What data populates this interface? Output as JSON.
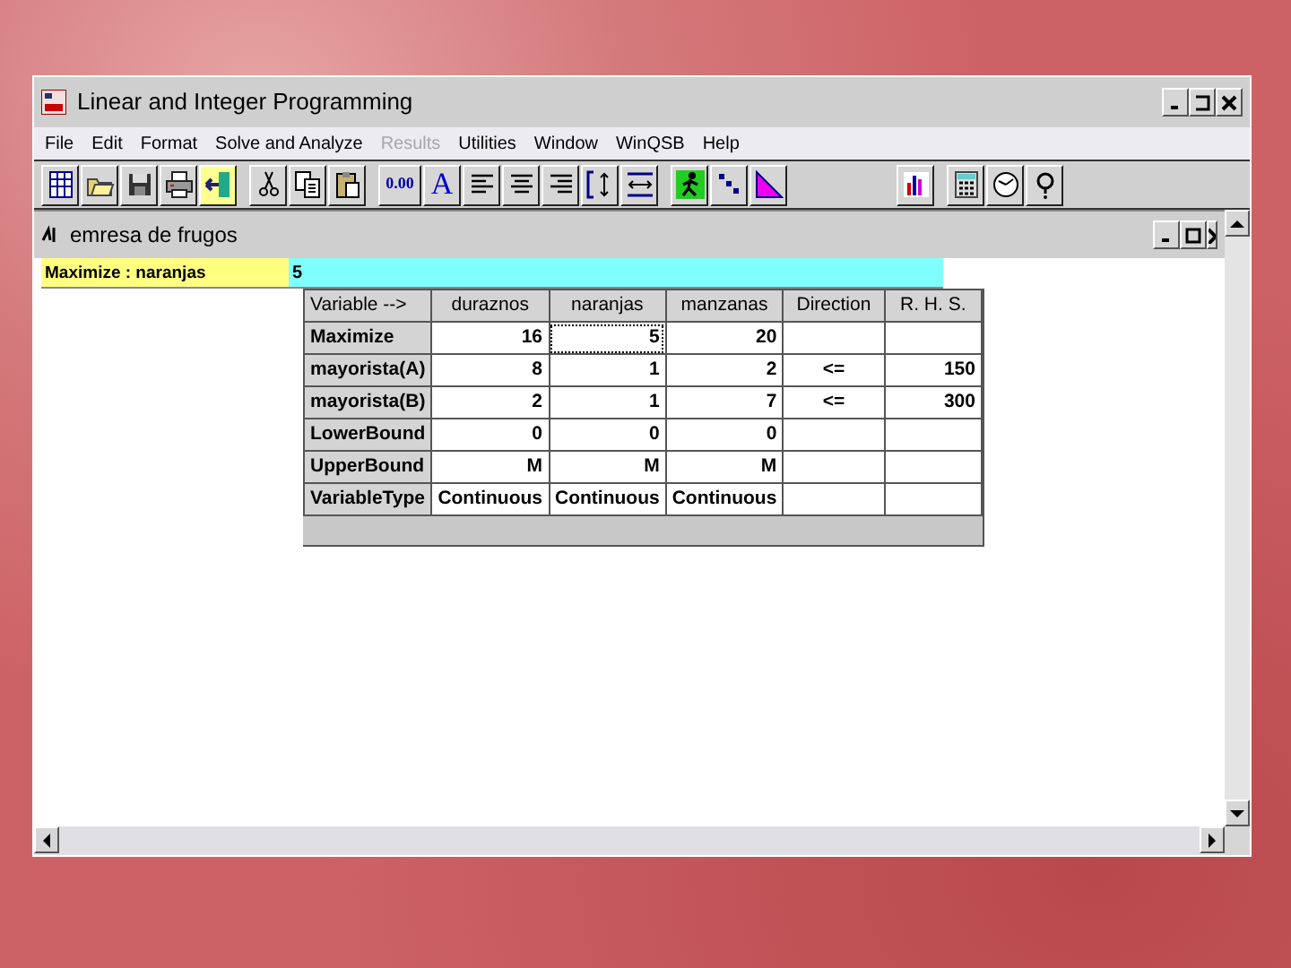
{
  "window": {
    "title": "Linear and Integer Programming"
  },
  "menu": [
    {
      "label": "File",
      "disabled": false
    },
    {
      "label": "Edit",
      "disabled": false
    },
    {
      "label": "Format",
      "disabled": false
    },
    {
      "label": "Solve and Analyze",
      "disabled": false
    },
    {
      "label": "Results",
      "disabled": true
    },
    {
      "label": "Utilities",
      "disabled": false
    },
    {
      "label": "Window",
      "disabled": false
    },
    {
      "label": "WinQSB",
      "disabled": false
    },
    {
      "label": "Help",
      "disabled": false
    }
  ],
  "toolbar": {
    "number_format": "0.00",
    "font": "A"
  },
  "document": {
    "title": "emresa de frugos",
    "cell_label": "Maximize : naranjas",
    "cell_value": "5",
    "table": {
      "columns": [
        "Variable -->",
        "duraznos",
        "naranjas",
        "manzanas",
        "Direction",
        "R. H. S."
      ],
      "rows": [
        [
          {
            "text": "Maximize",
            "selected": false
          },
          {
            "text": "16",
            "selected": false
          },
          {
            "text": "5",
            "selected": true
          },
          {
            "text": "20",
            "selected": false
          },
          {
            "text": "",
            "selected": false
          },
          {
            "text": "",
            "selected": false
          }
        ],
        [
          {
            "text": "mayorista(A)",
            "selected": false
          },
          {
            "text": "8",
            "selected": false
          },
          {
            "text": "1",
            "selected": false
          },
          {
            "text": "2",
            "selected": false
          },
          {
            "text": "<=",
            "selected": false
          },
          {
            "text": "150",
            "selected": false
          }
        ],
        [
          {
            "text": "mayorista(B)",
            "selected": false
          },
          {
            "text": "2",
            "selected": false
          },
          {
            "text": "1",
            "selected": false
          },
          {
            "text": "7",
            "selected": false
          },
          {
            "text": "<=",
            "selected": false
          },
          {
            "text": "300",
            "selected": false
          }
        ],
        [
          {
            "text": "LowerBound",
            "selected": false
          },
          {
            "text": "0",
            "selected": false
          },
          {
            "text": "0",
            "selected": false
          },
          {
            "text": "0",
            "selected": false
          },
          {
            "text": "",
            "selected": false
          },
          {
            "text": "",
            "selected": false
          }
        ],
        [
          {
            "text": "UpperBound",
            "selected": false
          },
          {
            "text": "M",
            "selected": false
          },
          {
            "text": "M",
            "selected": false
          },
          {
            "text": "M",
            "selected": false
          },
          {
            "text": "",
            "selected": false
          },
          {
            "text": "",
            "selected": false
          }
        ],
        [
          {
            "text": "VariableType",
            "selected": false
          },
          {
            "text": "Continuous",
            "selected": false
          },
          {
            "text": "Continuous",
            "selected": false
          },
          {
            "text": "Continuous",
            "selected": false
          },
          {
            "text": "",
            "selected": false
          },
          {
            "text": "",
            "selected": false
          }
        ]
      ]
    }
  }
}
